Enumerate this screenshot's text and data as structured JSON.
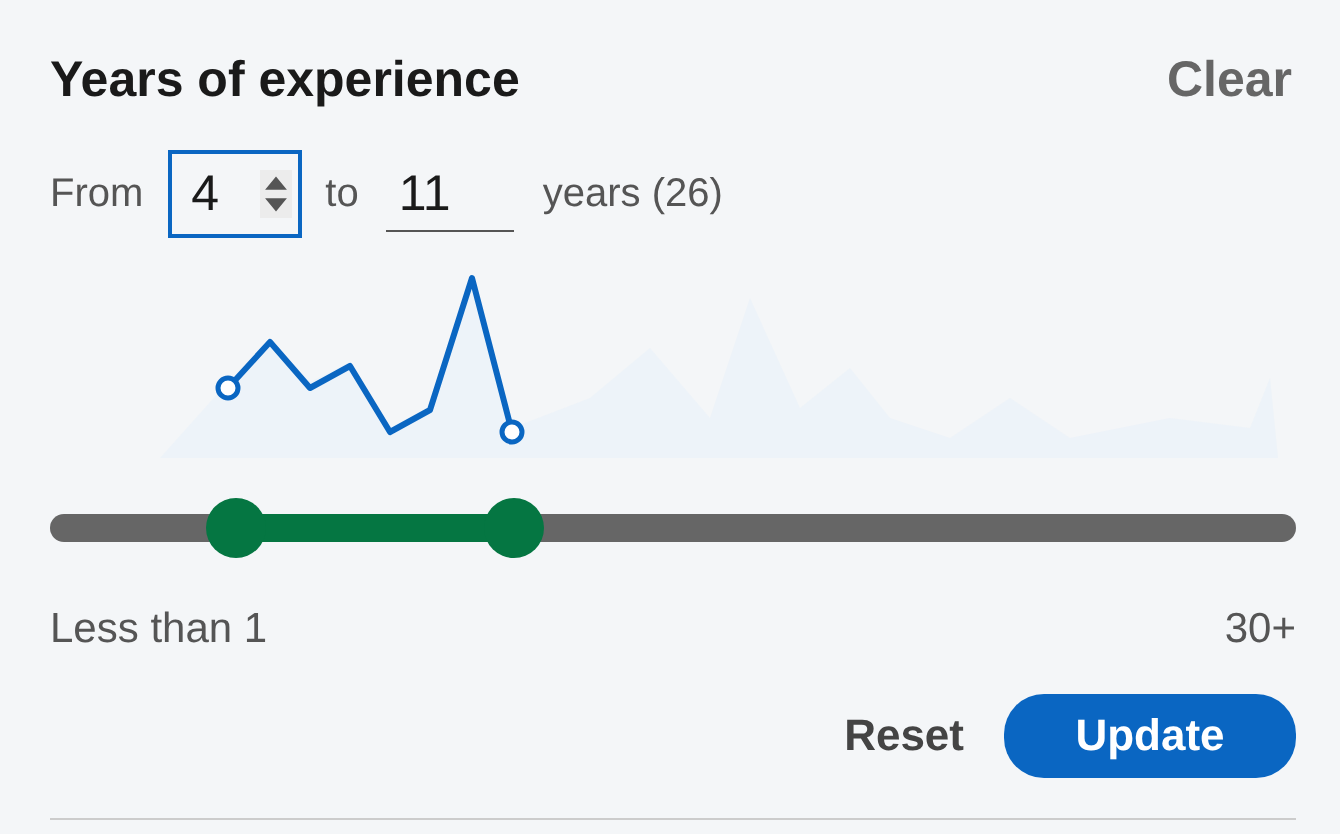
{
  "header": {
    "title": "Years of experience",
    "clear": "Clear"
  },
  "range": {
    "from_label": "From",
    "from_value": "4",
    "to_label": "to",
    "to_value": "11",
    "suffix": "years (26)"
  },
  "slider": {
    "thumbs": [
      {
        "level": 0.149
      },
      {
        "level": 0.372
      }
    ]
  },
  "scale": {
    "min_label": "Less than 1",
    "max_label": "30+"
  },
  "buttons": [
    {
      "label": "Reset",
      "kind": "text"
    },
    {
      "label": "Update",
      "kind": "primary"
    }
  ]
}
